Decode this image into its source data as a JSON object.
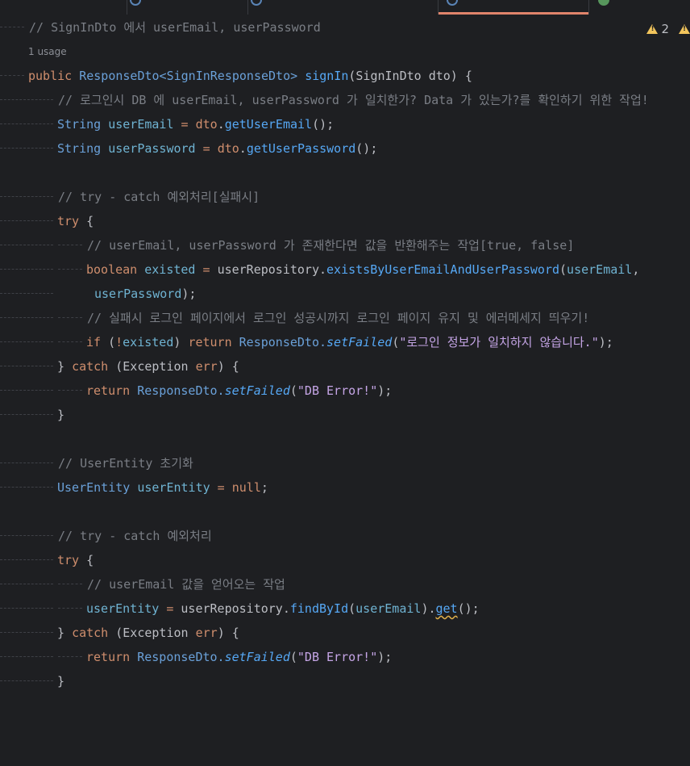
{
  "warning_count": "2",
  "usage_hint": "1 usage",
  "code": {
    "c_header": "// SignInDto 에서 userEmail, userPassword",
    "sig_public": "public ",
    "sig_type": "ResponseDto<SignInResponseDto>",
    "sig_name": "signIn",
    "sig_params": "(SignInDto dto) {",
    "c_intro": "// 로그인시 DB 에 userEmail, userPassword 가 일치한가? Data 가 있는가?를 확인하기 위한 작업!",
    "l_email_type": "String ",
    "l_email_var": "userEmail",
    "l_email_op": " = ",
    "l_email_obj": "dto",
    "l_email_dot": ".",
    "l_email_call": "getUserEmail",
    "l_email_end": "();",
    "l_pw_type": "String ",
    "l_pw_var": "userPassword",
    "l_pw_op": " = ",
    "l_pw_obj": "dto",
    "l_pw_dot": ".",
    "l_pw_call": "getUserPassword",
    "l_pw_end": "();",
    "c_try1": "// try - catch 예외처리[실패시]",
    "kw_try": "try",
    "brace_open": " {",
    "c_exists": "// userEmail, userPassword 가 존재한다면 값을 반환해주는 작업[true, false]",
    "b_type": "boolean ",
    "b_var": "existed",
    "b_op": " = ",
    "b_repo": "userRepository.",
    "b_call": "existsByUserEmailAndUserPassword",
    "b_paren": "(",
    "b_arg1": "userEmail",
    "b_comma": ",",
    "b_arg2": "userPassword",
    "b_end": ");",
    "c_fail": "// 실패시 로그인 페이지에서 로그인 성공시까지 로그인 페이지 유지 및 에러메세지 띄우기!",
    "if_kw": "if",
    "if_open": " (",
    "if_not": "!",
    "if_var": "existed",
    "if_close": ") ",
    "if_ret": "return ",
    "if_cls": "ResponseDto.",
    "if_call": "setFailed",
    "if_str": "\"로그인 정보가 일치하지 않습니다.\"",
    "catch_close": "} ",
    "catch_kw": "catch",
    "catch_sig": " (Exception ",
    "catch_err": "err",
    "catch_end": ") {",
    "ret_kw": "return ",
    "ret_cls": "ResponseDto.",
    "ret_call": "setFailed",
    "ret_str": "\"DB Error!\"",
    "close_brace": "}",
    "c_entity": "// UserEntity 초기화",
    "e_type": "UserEntity ",
    "e_var": "userEntity",
    "e_op": " = ",
    "e_null": "null",
    "e_end": ";",
    "c_try2": "// try - catch 예외처리",
    "c_get": "// userEmail 값을 얻어오는 작업",
    "f_var": "userEntity",
    "f_op": " = ",
    "f_repo": "userRepository.",
    "f_call": "findById",
    "f_arg": "userEmail",
    "f_dot": ").",
    "f_get": "get",
    "f_end": "();"
  }
}
